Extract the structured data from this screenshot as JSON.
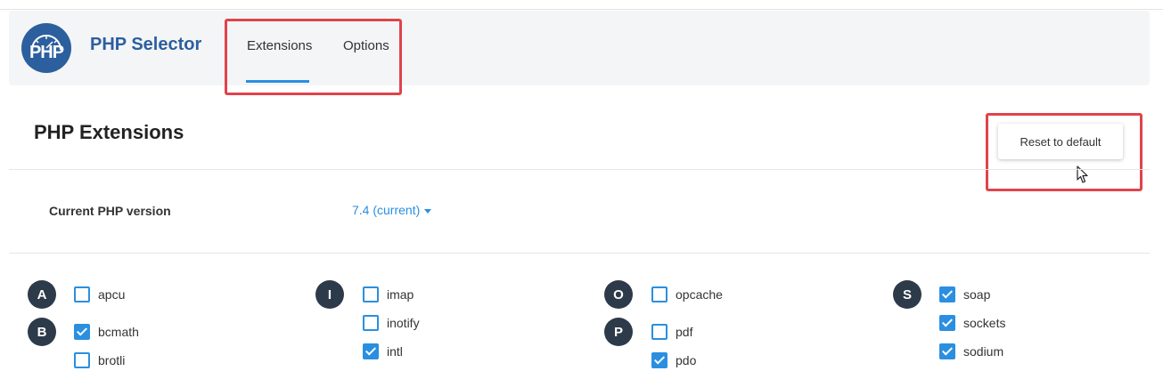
{
  "app": {
    "logo_text": "PHP",
    "title": "PHP Selector"
  },
  "tabs": [
    {
      "label": "Extensions",
      "active": true
    },
    {
      "label": "Options",
      "active": false
    }
  ],
  "page": {
    "title": "PHP Extensions",
    "reset_label": "Reset to default"
  },
  "version": {
    "label": "Current PHP version",
    "value": "7.4 (current)"
  },
  "letters": [
    "A",
    "B",
    "I",
    "O",
    "P",
    "S"
  ],
  "extensions": [
    {
      "name": "apcu",
      "checked": false
    },
    {
      "name": "bcmath",
      "checked": true
    },
    {
      "name": "brotli",
      "checked": false
    },
    {
      "name": "imap",
      "checked": false
    },
    {
      "name": "inotify",
      "checked": false
    },
    {
      "name": "intl",
      "checked": true
    },
    {
      "name": "opcache",
      "checked": false
    },
    {
      "name": "pdf",
      "checked": false
    },
    {
      "name": "pdo",
      "checked": true
    },
    {
      "name": "soap",
      "checked": true
    },
    {
      "name": "sockets",
      "checked": true
    },
    {
      "name": "sodium",
      "checked": true
    }
  ],
  "colors": {
    "accent": "#2a8fe0",
    "brand": "#2c5f9e",
    "highlight": "#e0434b",
    "letter_badge": "#2d3a4a"
  }
}
